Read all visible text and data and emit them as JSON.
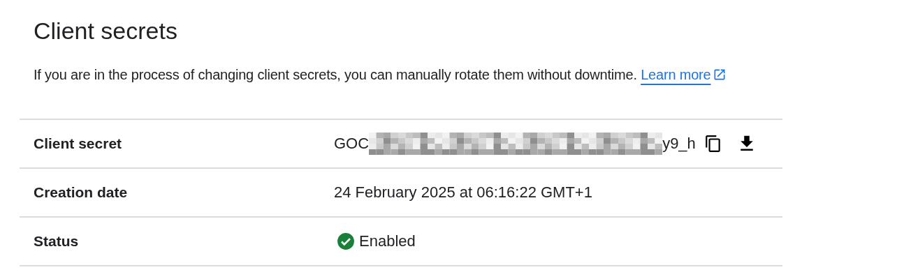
{
  "title": "Client secrets",
  "intro": {
    "text": "If you are in the process of changing client secrets, you can manually rotate them without downtime.",
    "link": "Learn more"
  },
  "rows": [
    {
      "kind": "secret",
      "label": "Client secret",
      "prefix": "GOC",
      "suffix": "y9_h",
      "redacted": true
    },
    {
      "kind": "text",
      "label": "Creation date",
      "value": "24 February 2025 at 06:16:22 GMT+1"
    },
    {
      "kind": "status",
      "label": "Status",
      "value": "Enabled"
    }
  ]
}
